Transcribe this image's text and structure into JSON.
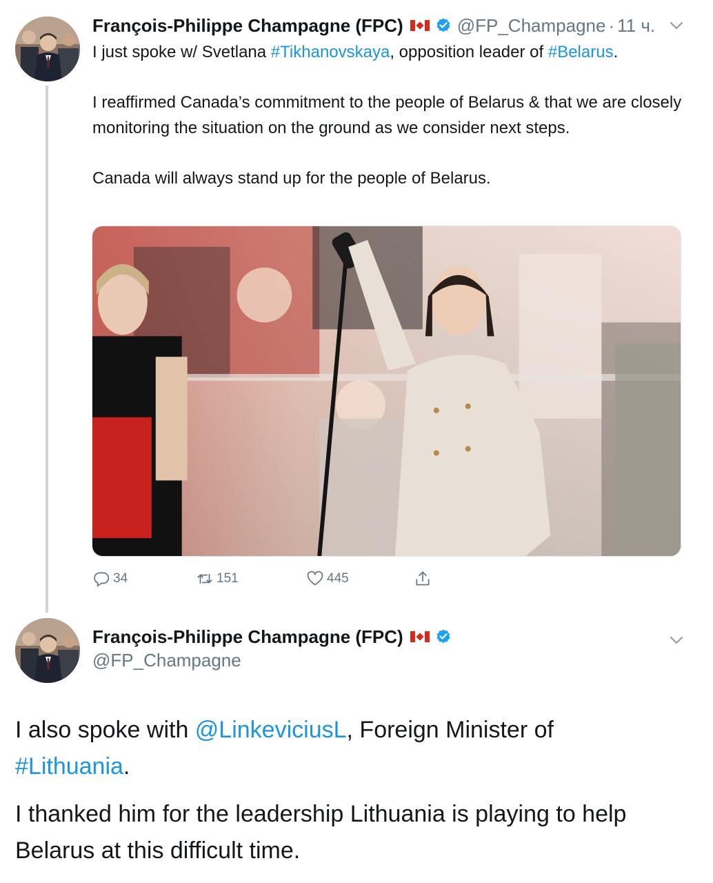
{
  "tweet1": {
    "author": {
      "name": "François-Philippe Champagne (FPC)",
      "handle": "@FP_Champagne",
      "separator": "·",
      "time": "11 ч."
    },
    "text": {
      "p1_prefix": "I just spoke w/ Svetlana ",
      "p1_hashtag1": "#Tikhanovskaya",
      "p1_middle": ", opposition leader of ",
      "p1_hashtag2": "#Belarus",
      "p1_suffix": ".",
      "p2": "I reaffirmed Canada’s commitment to the people of Belarus & that we are closely monitoring the situation on the ground as we consider next steps.",
      "p3": "Canada will always stand up for the people of Belarus."
    },
    "actions": {
      "replies": "34",
      "retweets": "151",
      "likes": "445"
    }
  },
  "tweet2": {
    "author": {
      "name": "François-Philippe Champagne (FPC)",
      "handle": "@FP_Champagne"
    },
    "text": {
      "p1_prefix": "I also spoke with ",
      "p1_mention": "@LinkeviciusL",
      "p1_middle": ", Foreign Minister of ",
      "p1_hashtag": "#Lithuania",
      "p1_suffix": ".",
      "p2": "I thanked him for the leadership Lithuania is playing to help Belarus at this difficult time."
    }
  },
  "colors": {
    "link": "#1b95e0",
    "muted": "#657786",
    "verified": "#1da1f2",
    "text": "#14171a"
  }
}
